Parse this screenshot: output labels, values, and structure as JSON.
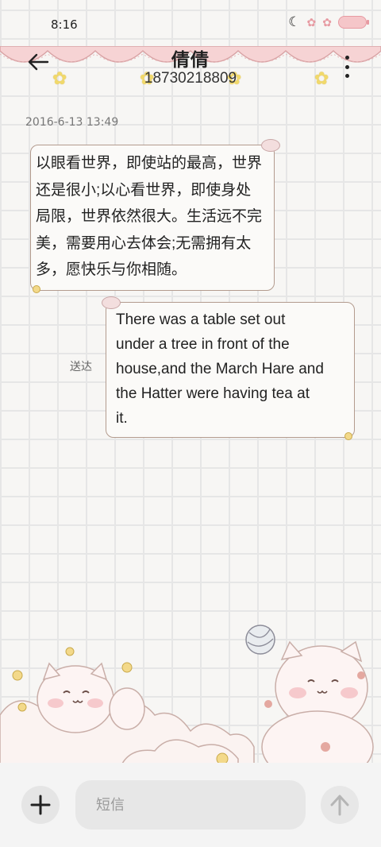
{
  "status_bar": {
    "time": "8:16",
    "icons": [
      "moon-icon",
      "paw-icon",
      "paw-icon",
      "battery-icon"
    ]
  },
  "header": {
    "name": "倩倩",
    "number": "18730218809",
    "back_icon": "arrow-left-icon",
    "more_icon": "more-vertical-icon"
  },
  "conversation": {
    "timestamp": "2016-6-13 13:49",
    "messages": [
      {
        "direction": "incoming",
        "lines": [
          "以眼看世界，即使站的最高，世界",
          "还是很小;以心看世界，即使身处",
          "局限，世界依然很大。生活远不完",
          "美，需要用心去体会;无需拥有太",
          "多，愿快乐与你相随。"
        ]
      },
      {
        "direction": "outgoing",
        "status": "送达",
        "lines": [
          "There was a table set out",
          "under a tree in front of the",
          "house,and the March Hare and",
          "the Hatter were having tea at",
          "it."
        ]
      }
    ]
  },
  "composer": {
    "placeholder": "短信",
    "add_icon": "plus-icon",
    "send_icon": "arrow-up-icon"
  },
  "colors": {
    "background": "#f7f6f4",
    "grid": "#e6e6e6",
    "bubble_border": "#b39b8e",
    "scallop_pink": "#f6d3d4",
    "star_yellow": "#f1d96b"
  }
}
